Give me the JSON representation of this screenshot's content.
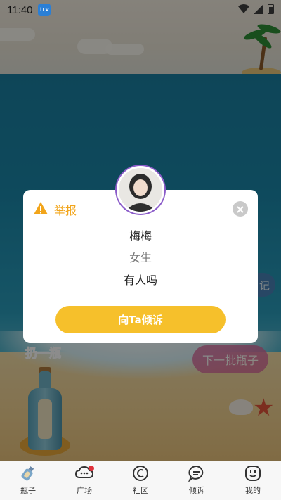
{
  "status_bar": {
    "time": "11:40",
    "app_badge": "iTV"
  },
  "scene": {
    "throw_label": "扔一瓶",
    "next_batch_label": "下一批瓶子",
    "side_pill_label": "记"
  },
  "dialog": {
    "report_label": "举报",
    "name": "梅梅",
    "gender": "女生",
    "message": "有人吗",
    "action_label": "向Ta倾诉"
  },
  "tabbar": {
    "items": [
      {
        "label": "瓶子",
        "icon": "bottle-icon",
        "active": true
      },
      {
        "label": "广场",
        "icon": "cloud-chat-icon",
        "badge": true
      },
      {
        "label": "社区",
        "icon": "community-icon"
      },
      {
        "label": "倾诉",
        "icon": "message-bubble-icon"
      },
      {
        "label": "我的",
        "icon": "smile-face-icon"
      }
    ]
  },
  "colors": {
    "accent_yellow": "#f6c02b",
    "report_orange": "#f2a51a",
    "avatar_ring": "#8b5cc9",
    "badge_red": "#e0303a"
  }
}
